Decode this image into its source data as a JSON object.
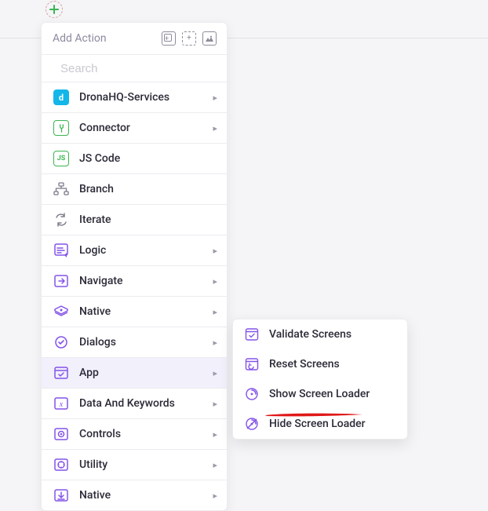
{
  "header": {
    "title": "Add Action"
  },
  "search": {
    "placeholder": "Search"
  },
  "items": [
    {
      "label": "DronaHQ-Services",
      "has_sub": true
    },
    {
      "label": "Connector",
      "has_sub": true
    },
    {
      "label": "JS Code",
      "has_sub": false
    },
    {
      "label": "Branch",
      "has_sub": false
    },
    {
      "label": "Iterate",
      "has_sub": false
    },
    {
      "label": "Logic",
      "has_sub": true
    },
    {
      "label": "Navigate",
      "has_sub": true
    },
    {
      "label": "Native",
      "has_sub": true
    },
    {
      "label": "Dialogs",
      "has_sub": true
    },
    {
      "label": "App",
      "has_sub": true,
      "selected": true
    },
    {
      "label": "Data And Keywords",
      "has_sub": true
    },
    {
      "label": "Controls",
      "has_sub": true
    },
    {
      "label": "Utility",
      "has_sub": true
    },
    {
      "label": "Native",
      "has_sub": true
    }
  ],
  "submenu": {
    "items": [
      {
        "label": "Validate Screens"
      },
      {
        "label": "Reset Screens"
      },
      {
        "label": "Show Screen Loader"
      },
      {
        "label": "Hide Screen Loader",
        "underlined": true
      }
    ]
  }
}
